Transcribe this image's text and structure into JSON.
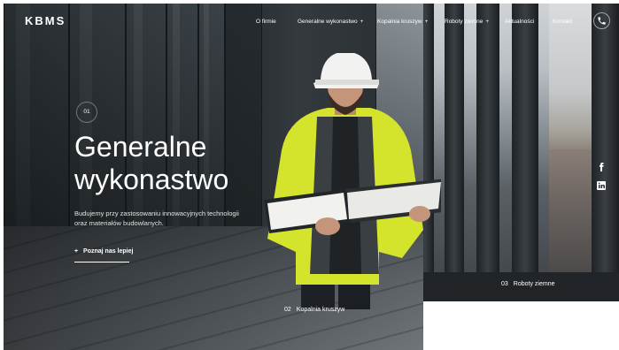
{
  "brand": {
    "logo_text": "KBMS"
  },
  "nav": {
    "items": [
      {
        "label": "O firmie",
        "has_submenu": false
      },
      {
        "label": "Generalne wykonastwo",
        "has_submenu": true
      },
      {
        "label": "Kopalnia kruszyw",
        "has_submenu": true
      },
      {
        "label": "Roboty ziemne",
        "has_submenu": true
      },
      {
        "label": "Aktualności",
        "has_submenu": false
      },
      {
        "label": "Kontakt",
        "has_submenu": false
      }
    ],
    "submenu_marker": "+",
    "phone_icon": "phone-icon"
  },
  "hero": {
    "slide_number": "01",
    "title_line1": "Generalne",
    "title_line2": "wykonastwo",
    "description": "Budujemy przy zastosowaniu innowacyjnych technologii oraz materiałów budowlanych.",
    "cta_marker": "+",
    "cta_label": "Poznaj nas lepiej"
  },
  "slides": [
    {
      "number": "02",
      "label": "Kopalnia kruszyw"
    },
    {
      "number": "03",
      "label": "Roboty ziemne"
    }
  ],
  "social": [
    {
      "icon": "facebook-icon"
    },
    {
      "icon": "linkedin-icon"
    }
  ],
  "colors": {
    "accent_vest": "#d7e62c",
    "text": "#ffffff",
    "dark": "#22272a"
  }
}
